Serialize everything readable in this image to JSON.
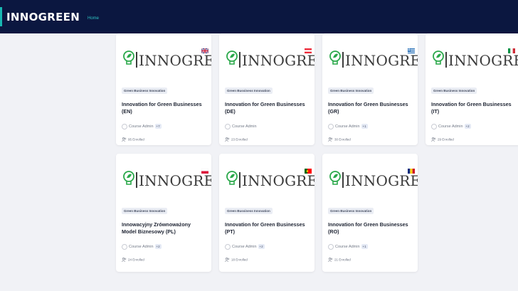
{
  "header": {
    "brand": "INNOGREEN",
    "nav_home": "Home"
  },
  "colors": {
    "topbar": "#0b1740",
    "accent": "#2fc3c2",
    "logo_green": "#2aa84a"
  },
  "courses": [
    {
      "logo_text": "INNOGREEN",
      "tag": "Green Business Innovation",
      "title": "Innovation for Green Businesses (EN)",
      "author": "Course Admin",
      "extra": "+7",
      "enrolled": "95 Enrolled",
      "flag": "uk-flag"
    },
    {
      "logo_text": "INNOGREEN",
      "tag": "Green Bussiness Innovation",
      "title": "Innovation for Green Businesses (DE)",
      "author": "Course Admin",
      "extra": "",
      "enrolled": "23 Enrolled",
      "flag": "austria-flag"
    },
    {
      "logo_text": "INNOGREEN",
      "tag": "Green Business Innovation",
      "title": "Innovation for Green Businesses (GR)",
      "author": "Course Admin",
      "extra": "+1",
      "enrolled": "30 Enrolled",
      "flag": "greece-flag"
    },
    {
      "logo_text": "INNOGREEN",
      "tag": "Green Business Innovation",
      "title": "Innovation for Green Businesses (IT)",
      "author": "Course Admin",
      "extra": "+2",
      "enrolled": "29 Enrolled",
      "flag": "italy-flag"
    },
    {
      "logo_text": "INNOGREEN",
      "tag": "Green Business Innovation",
      "title": "Innowacyjny Zrównoważony Model Biznesowy (PL)",
      "author": "Course Admin",
      "extra": "+2",
      "enrolled": "24 Enrolled",
      "flag": "poland-flag"
    },
    {
      "logo_text": "INNOGREEN",
      "tag": "Green Bussiness Innovation",
      "title": "Innovation for Green Businesses (PT)",
      "author": "Course Admin",
      "extra": "+2",
      "enrolled": "18 Enrolled",
      "flag": "portugal-flag"
    },
    {
      "logo_text": "INNOGREEN",
      "tag": "Green Business Innovation",
      "title": "Innovation for Green Businesses (RO)",
      "author": "Course Admin",
      "extra": "+1",
      "enrolled": "21 Enrolled",
      "flag": "romania-flag"
    }
  ]
}
